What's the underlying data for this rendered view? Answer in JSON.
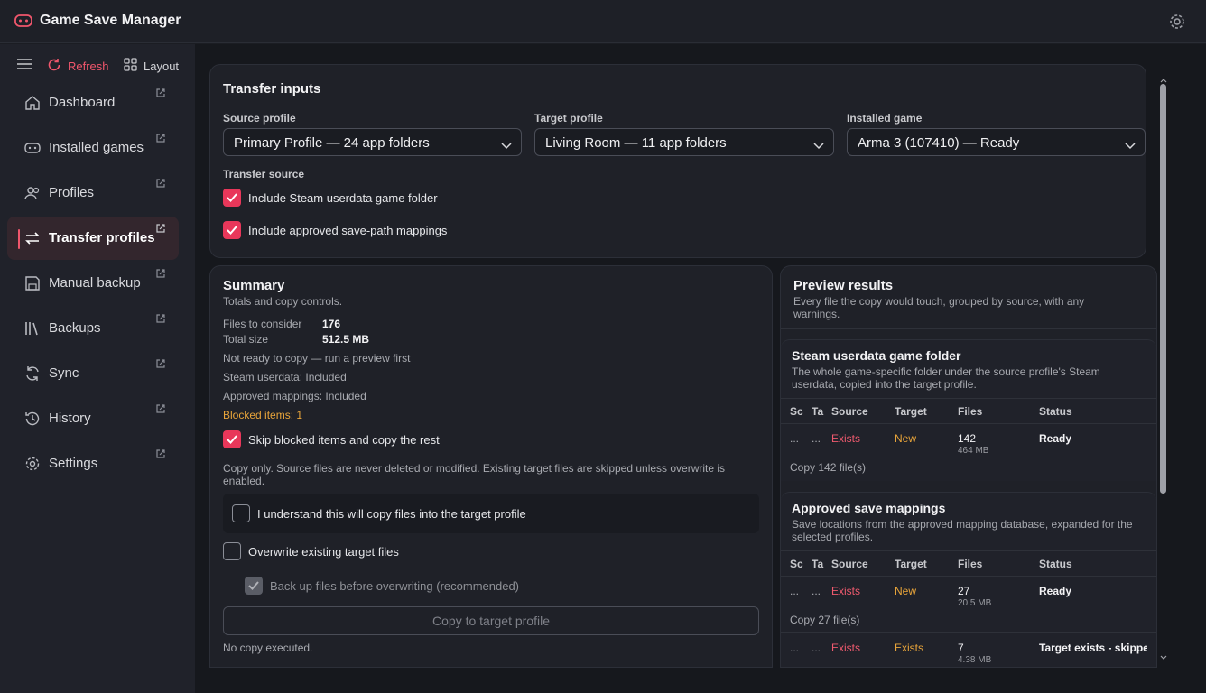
{
  "app": {
    "title": "Game Save Manager"
  },
  "toolbar": {
    "refresh": "Refresh",
    "layout": "Layout"
  },
  "nav": [
    {
      "label": "Dashboard",
      "icon": "home-icon"
    },
    {
      "label": "Installed games",
      "icon": "gamepad-icon"
    },
    {
      "label": "Profiles",
      "icon": "users-icon"
    },
    {
      "label": "Transfer profiles",
      "icon": "transfer-icon",
      "active": true
    },
    {
      "label": "Manual backup",
      "icon": "save-icon"
    },
    {
      "label": "Backups",
      "icon": "library-icon"
    },
    {
      "label": "Sync",
      "icon": "sync-icon"
    },
    {
      "label": "History",
      "icon": "history-icon"
    },
    {
      "label": "Settings",
      "icon": "gear-icon"
    }
  ],
  "inputs": {
    "title": "Transfer inputs",
    "source_label": "Source profile",
    "source_value": "Primary Profile — 24 app folders",
    "target_label": "Target profile",
    "target_value": "Living Room — 11 app folders",
    "game_label": "Installed game",
    "game_value": "Arma 3 (107410) — Ready",
    "transfer_source_label": "Transfer source",
    "opt_steam": "Include Steam userdata game folder",
    "opt_mappings": "Include approved save-path mappings"
  },
  "summary": {
    "title": "Summary",
    "subtitle": "Totals and copy controls.",
    "files_label": "Files to consider",
    "files_value": "176",
    "size_label": "Total size",
    "size_value": "512.5 MB",
    "status": "Not ready to copy — run a preview first",
    "steam": "Steam userdata: Included",
    "mappings": "Approved mappings: Included",
    "blocked": "Blocked items: 1",
    "skip_label": "Skip blocked items and copy the rest",
    "note": "Copy only. Source files are never deleted or modified. Existing target files are skipped unless overwrite is enabled.",
    "understand_label": "I understand this will copy files into the target profile",
    "overwrite_label": "Overwrite existing target files",
    "backup_label": "Back up files before overwriting (recommended)",
    "copy_button": "Copy to target profile",
    "result": "No copy executed."
  },
  "preview": {
    "title": "Preview results",
    "subtitle": "Every file the copy would touch, grouped by source, with any warnings.",
    "columns": [
      "Sc",
      "Ta",
      "Source",
      "Target",
      "Files",
      "Status"
    ],
    "steam": {
      "title": "Steam userdata game folder",
      "desc": "The whole game-specific folder under the source profile's Steam userdata, copied into the target profile.",
      "row": {
        "sc": "...",
        "ta": "...",
        "source": "Exists",
        "target": "New",
        "files": "142",
        "size": "464 MB",
        "status": "Ready"
      },
      "footer": "Copy 142 file(s)"
    },
    "mappings": {
      "title": "Approved save mappings",
      "desc": "Save locations from the approved mapping database, expanded for the selected profiles.",
      "rows": [
        {
          "sc": "...",
          "ta": "...",
          "source": "Exists",
          "target": "New",
          "files": "27",
          "size": "20.5 MB",
          "status": "Ready"
        },
        {
          "sc": "...",
          "ta": "...",
          "source": "Exists",
          "target": "Exists",
          "files": "7",
          "size": "4.38 MB",
          "status": "Target exists - skipped"
        }
      ],
      "footer": "Copy 27 file(s)"
    }
  },
  "colors": {
    "accent": "#e8375a",
    "warning": "#e9a53a"
  }
}
